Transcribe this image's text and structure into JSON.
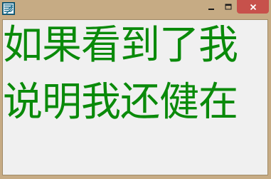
{
  "window": {
    "app_icon": "app-logo-icon",
    "controls": {
      "minimize_icon": "minimize-icon",
      "maximize_icon": "maximize-icon",
      "close_icon": "close-icon",
      "close_color": "#c7514b"
    }
  },
  "content": {
    "text_color": "#0a8a0a",
    "background": "#f0f0f0",
    "line1": "如果看到了我",
    "line2": "说明我还健在"
  }
}
